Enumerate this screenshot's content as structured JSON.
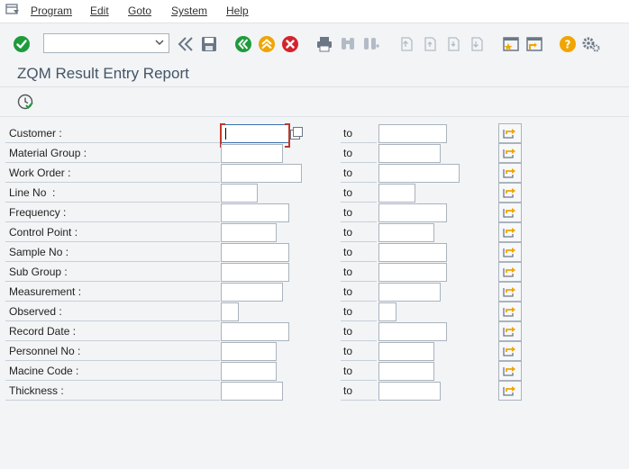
{
  "menu": {
    "items": [
      {
        "id": "program",
        "label": "Program"
      },
      {
        "id": "edit",
        "label": "Edit"
      },
      {
        "id": "goto",
        "label": "Goto"
      },
      {
        "id": "system",
        "label": "System"
      },
      {
        "id": "help",
        "label": "Help"
      }
    ]
  },
  "toolbar": {
    "command_value": "",
    "icons": [
      "enter-icon",
      "back-icon",
      "save-icon",
      "back-green-icon",
      "exit-icon",
      "cancel-icon",
      "print-icon",
      "find-icon",
      "find-next-icon",
      "first-page-icon",
      "previous-page-icon",
      "next-page-icon",
      "last-page-icon",
      "create-session-icon",
      "shortcut-icon",
      "help-icon",
      "settings-icon"
    ]
  },
  "page": {
    "title": "ZQM Result Entry Report"
  },
  "appbar": {
    "icons": [
      "execute-icon"
    ]
  },
  "form": {
    "to_label": "to",
    "rows": [
      {
        "id": "customer",
        "label": "Customer :",
        "low": "",
        "high": ""
      },
      {
        "id": "material-group",
        "label": "Material Group :",
        "low": "",
        "high": ""
      },
      {
        "id": "work-order",
        "label": "Work Order :",
        "low": "",
        "high": ""
      },
      {
        "id": "line-no",
        "label": "Line No  :",
        "low": "",
        "high": ""
      },
      {
        "id": "frequency",
        "label": "Frequency :",
        "low": "",
        "high": ""
      },
      {
        "id": "control-point",
        "label": "Control Point :",
        "low": "",
        "high": ""
      },
      {
        "id": "sample-no",
        "label": "Sample No :",
        "low": "",
        "high": ""
      },
      {
        "id": "sub-group",
        "label": "Sub Group :",
        "low": "",
        "high": ""
      },
      {
        "id": "measurement",
        "label": "Measurement :",
        "low": "",
        "high": ""
      },
      {
        "id": "observed",
        "label": "Observed :",
        "low": "",
        "high": ""
      },
      {
        "id": "record-date",
        "label": "Record Date :",
        "low": "",
        "high": ""
      },
      {
        "id": "personnel-no",
        "label": "Personnel No :",
        "low": "",
        "high": ""
      },
      {
        "id": "macine-code",
        "label": "Macine Code :",
        "low": "",
        "high": ""
      },
      {
        "id": "thickness",
        "label": "Thickness :",
        "low": "",
        "high": ""
      }
    ]
  },
  "colors": {
    "accent_green": "#1e9b3b",
    "accent_yellow": "#f0a500",
    "accent_red": "#d3242e",
    "title": "#445566"
  }
}
